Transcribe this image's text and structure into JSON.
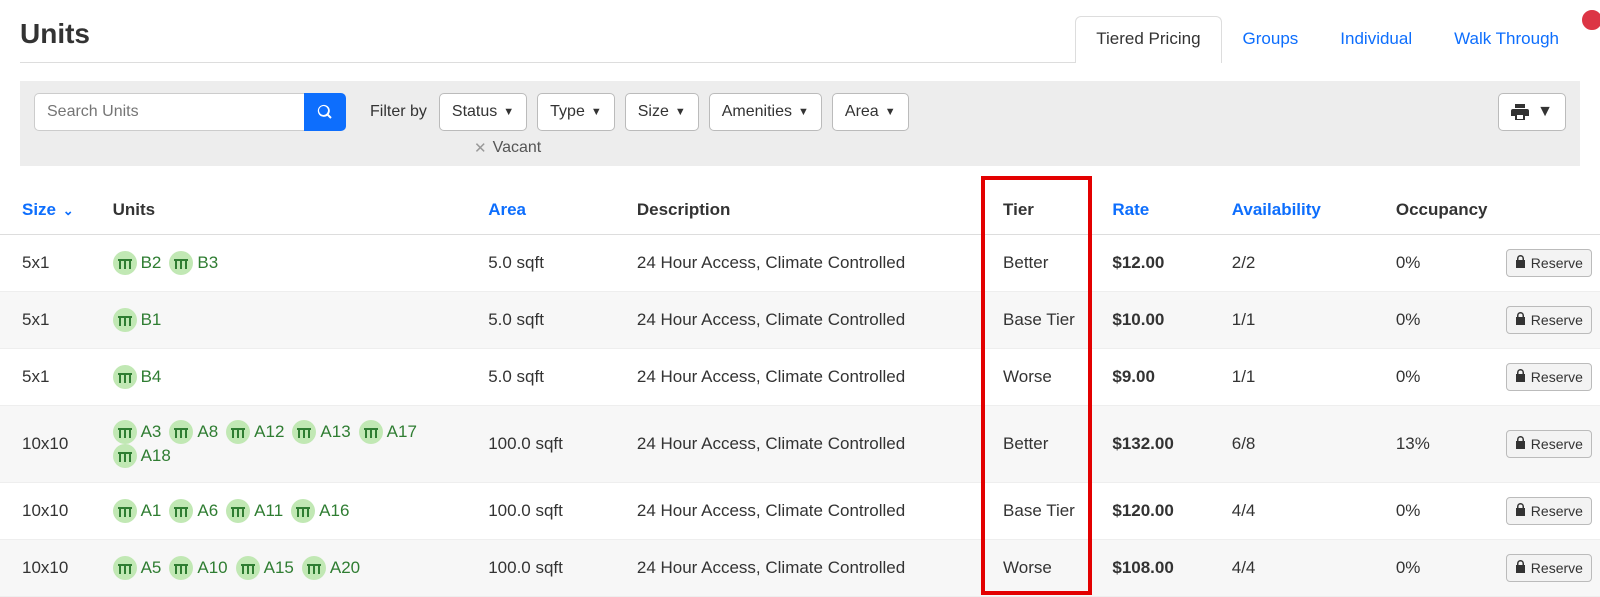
{
  "page_title": "Units",
  "tabs": [
    {
      "label": "Tiered Pricing",
      "active": true
    },
    {
      "label": "Groups",
      "active": false
    },
    {
      "label": "Individual",
      "active": false
    },
    {
      "label": "Walk Through",
      "active": false
    }
  ],
  "search_placeholder": "Search Units",
  "filter_label": "Filter by",
  "filter_dropdowns": [
    "Status",
    "Type",
    "Size",
    "Amenities",
    "Area"
  ],
  "active_filters": [
    {
      "label": "Vacant"
    }
  ],
  "columns": {
    "size": "Size",
    "units": "Units",
    "area": "Area",
    "description": "Description",
    "tier": "Tier",
    "rate": "Rate",
    "availability": "Availability",
    "occupancy": "Occupancy"
  },
  "reserve_label": "Reserve",
  "rows": [
    {
      "size": "5x1",
      "units": [
        "B2",
        "B3"
      ],
      "area": "5.0 sqft",
      "description": "24 Hour Access, Climate Controlled",
      "tier": "Better",
      "rate": "$12.00",
      "availability": "2/2",
      "occupancy": "0%"
    },
    {
      "size": "5x1",
      "units": [
        "B1"
      ],
      "area": "5.0 sqft",
      "description": "24 Hour Access, Climate Controlled",
      "tier": "Base Tier",
      "rate": "$10.00",
      "availability": "1/1",
      "occupancy": "0%"
    },
    {
      "size": "5x1",
      "units": [
        "B4"
      ],
      "area": "5.0 sqft",
      "description": "24 Hour Access, Climate Controlled",
      "tier": "Worse",
      "rate": "$9.00",
      "availability": "1/1",
      "occupancy": "0%"
    },
    {
      "size": "10x10",
      "units": [
        "A3",
        "A8",
        "A12",
        "A13",
        "A17",
        "A18"
      ],
      "area": "100.0 sqft",
      "description": "24 Hour Access, Climate Controlled",
      "tier": "Better",
      "rate": "$132.00",
      "availability": "6/8",
      "occupancy": "13%"
    },
    {
      "size": "10x10",
      "units": [
        "A1",
        "A6",
        "A11",
        "A16"
      ],
      "area": "100.0 sqft",
      "description": "24 Hour Access, Climate Controlled",
      "tier": "Base Tier",
      "rate": "$120.00",
      "availability": "4/4",
      "occupancy": "0%"
    },
    {
      "size": "10x10",
      "units": [
        "A5",
        "A10",
        "A15",
        "A20"
      ],
      "area": "100.0 sqft",
      "description": "24 Hour Access, Climate Controlled",
      "tier": "Worse",
      "rate": "$108.00",
      "availability": "4/4",
      "occupancy": "0%"
    }
  ]
}
